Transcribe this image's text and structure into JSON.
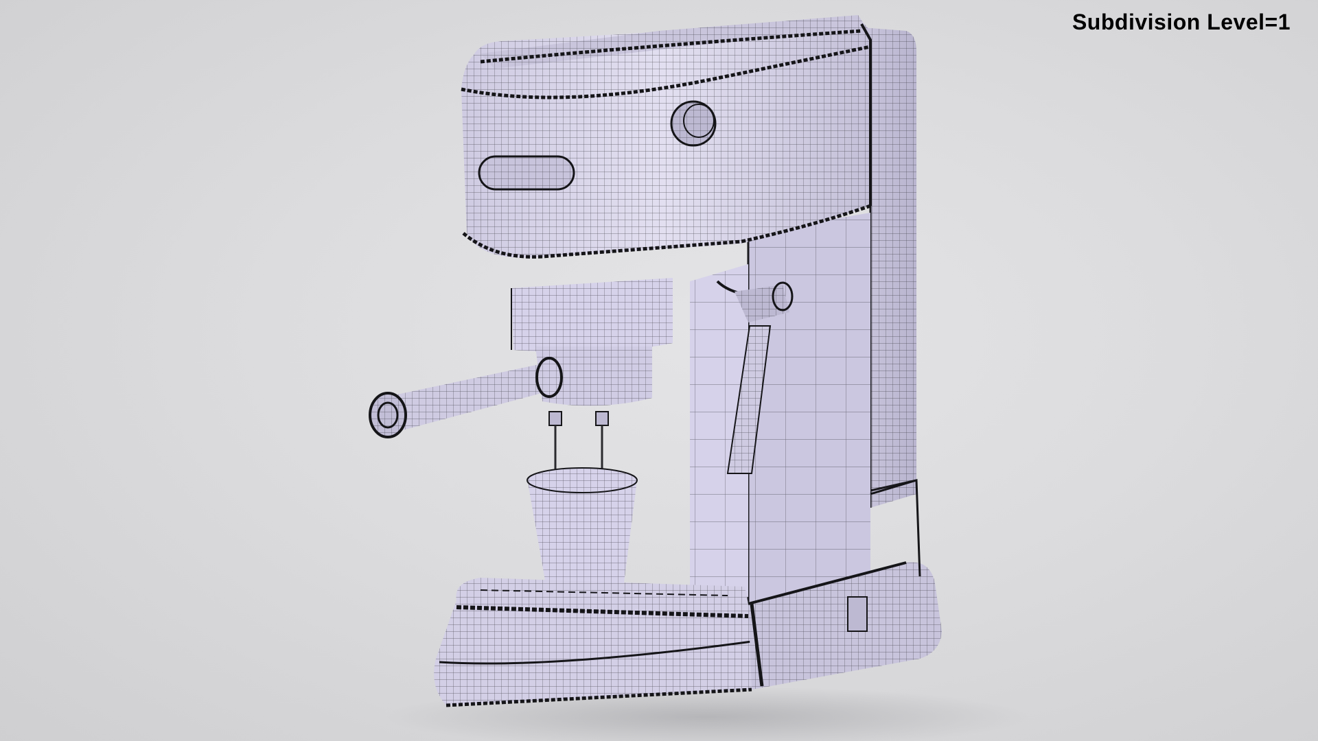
{
  "overlay": {
    "label": "Subdivision Level=1"
  },
  "render": {
    "subject_icon": "espresso-machine-icon",
    "background_color": "#dcdcde",
    "mesh_fill_color": "#d9d6ea",
    "wireframe_color": "#2a2a2e"
  }
}
